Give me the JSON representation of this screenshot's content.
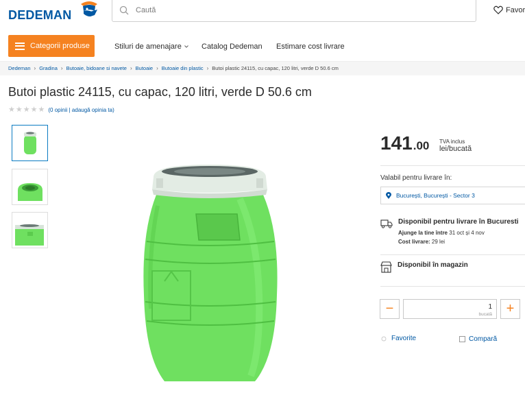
{
  "header": {
    "logo_text": "DEDEMAN",
    "search_placeholder": "Caută",
    "favorites_label": "Favor"
  },
  "nav": {
    "categories_label": "Categorii produse",
    "links": [
      "Stiluri de amenajare",
      "Catalog Dedeman",
      "Estimare cost livrare"
    ]
  },
  "breadcrumb": [
    "Dedeman",
    "Gradina",
    "Butoaie, bidoane si navete",
    "Butoaie",
    "Butoaie din plastic",
    "Butoi plastic 24115, cu capac, 120 litri, verde D 50.6 cm"
  ],
  "product": {
    "title": "Butoi plastic 24115, cu capac, 120 litri, verde D 50.6 cm",
    "reviews_text": "(0 opinii | adaugă opinia ta)",
    "rating_stars": 0,
    "max_stars": 5
  },
  "price": {
    "integer": "141",
    "decimal": ".00",
    "vat": "TVA inclus",
    "unit": "lei/bucată"
  },
  "delivery": {
    "valid_label": "Valabil pentru livrare în:",
    "location": "București, București - Sector 3",
    "title": "Disponibil pentru livrare în Bucuresti",
    "arrival_label": "Ajunge la tine între",
    "arrival_value": "31 oct și 4 nov",
    "cost_label": "Cost livrare:",
    "cost_value": "29 lei"
  },
  "store": {
    "title": "Disponibil în magazin"
  },
  "quantity": {
    "value": "1",
    "unit": "bucată",
    "minus": "−",
    "plus": "+"
  },
  "actions": {
    "favorite": "Favorite",
    "compare": "Compară"
  },
  "colors": {
    "accent": "#f58220",
    "brand_blue": "#0058a3",
    "product_green": "#6fe060"
  },
  "icons": [
    "search-icon",
    "heart-icon",
    "menu-icon",
    "chevron-right-icon",
    "star-icon",
    "map-pin-icon",
    "truck-icon",
    "store-icon"
  ]
}
